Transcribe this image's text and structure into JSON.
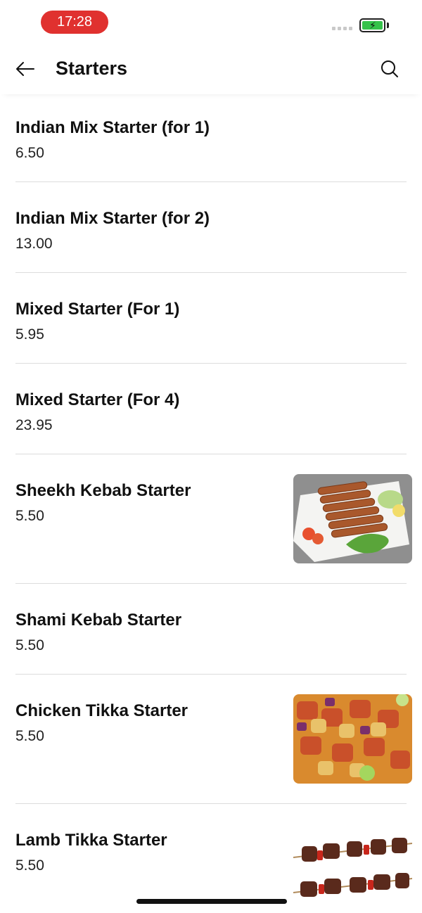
{
  "status_bar": {
    "time": "17:28",
    "battery_icon": "battery-charging-icon",
    "signal_icon": "signal-icon"
  },
  "header": {
    "title": "Starters",
    "back_icon": "arrow-left-icon",
    "search_icon": "search-icon"
  },
  "items": [
    {
      "name": "Indian Mix Starter (for 1)",
      "price": "6.50"
    },
    {
      "name": "Indian Mix Starter (for 2)",
      "price": "13.00"
    },
    {
      "name": "Mixed Starter (For 1)",
      "price": "5.95"
    },
    {
      "name": "Mixed Starter (For 4)",
      "price": "23.95"
    },
    {
      "name": "Sheekh Kebab Starter",
      "price": "5.50",
      "image": "seekh-kebab-photo"
    },
    {
      "name": "Shami Kebab Starter",
      "price": "5.50"
    },
    {
      "name": "Chicken Tikka Starter",
      "price": "5.50",
      "image": "chicken-tikka-skewers-photo"
    },
    {
      "name": "Lamb Tikka Starter",
      "price": "5.50",
      "image": "lamb-tikka-skewers-photo"
    }
  ],
  "colors": {
    "time_pill": "#e0312f",
    "battery_fill": "#35c24a",
    "divider": "#dcdcdc"
  }
}
